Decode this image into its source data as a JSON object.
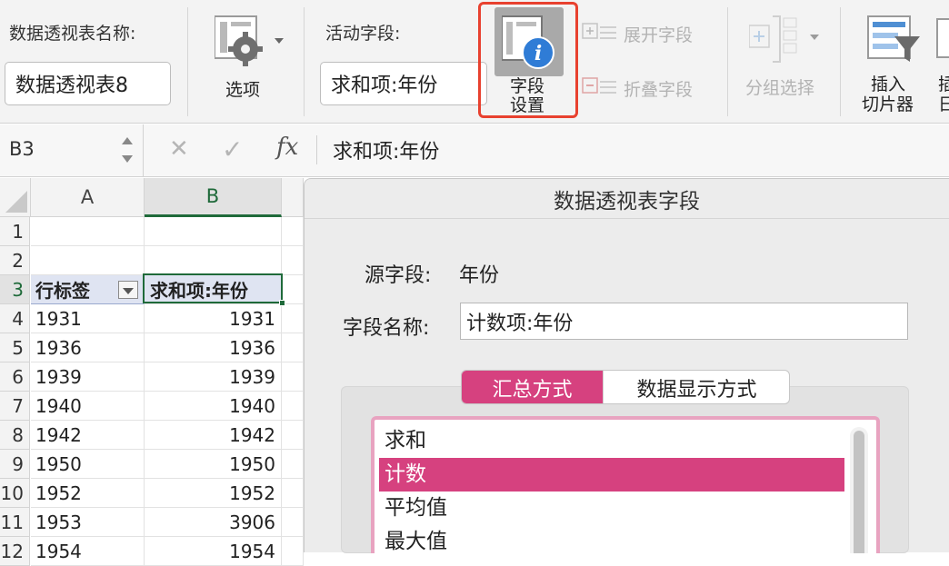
{
  "ribbon": {
    "pivot_name_label": "数据透视表名称:",
    "pivot_name_value": "数据透视表8",
    "options_label": "选项",
    "active_field_label": "活动字段:",
    "active_field_value": "求和项:年份",
    "field_settings_line1": "字段",
    "field_settings_line2": "设置",
    "expand_field_label": "展开字段",
    "collapse_field_label": "折叠字段",
    "group_selection_label": "分组选择",
    "insert_slicer_line1": "插入",
    "insert_slicer_line2": "切片器",
    "cut_partial_line1": "插",
    "cut_partial_line2": "日",
    "highlight_color": "#e8412f"
  },
  "formula_bar": {
    "name_box": "B3",
    "cancel_symbol": "✕",
    "confirm_symbol": "✓",
    "fx_symbol": "fx",
    "formula": "求和项:年份"
  },
  "sheet": {
    "columns": [
      "A",
      "B"
    ],
    "rows": [
      {
        "num": "1",
        "a": "",
        "b": ""
      },
      {
        "num": "2",
        "a": "",
        "b": ""
      },
      {
        "num": "3",
        "a": "行标签",
        "b": "求和项:年份"
      },
      {
        "num": "4",
        "a": "1931",
        "b": "1931"
      },
      {
        "num": "5",
        "a": "1936",
        "b": "1936"
      },
      {
        "num": "6",
        "a": "1939",
        "b": "1939"
      },
      {
        "num": "7",
        "a": "1940",
        "b": "1940"
      },
      {
        "num": "8",
        "a": "1942",
        "b": "1942"
      },
      {
        "num": "9",
        "a": "1950",
        "b": "1950"
      },
      {
        "num": "10",
        "a": "1952",
        "b": "1952"
      },
      {
        "num": "11",
        "a": "1953",
        "b": "3906"
      },
      {
        "num": "12",
        "a": "1954",
        "b": "1954"
      }
    ]
  },
  "dialog": {
    "title": "数据透视表字段",
    "source_field_label": "源字段:",
    "source_field_value": "年份",
    "field_name_label": "字段名称:",
    "field_name_value": "计数项:年份",
    "tab_summary": "汇总方式",
    "tab_display": "数据显示方式",
    "functions": [
      "求和",
      "计数",
      "平均值",
      "最大值"
    ],
    "selected_index": 1,
    "accent_color": "#d6417f"
  }
}
